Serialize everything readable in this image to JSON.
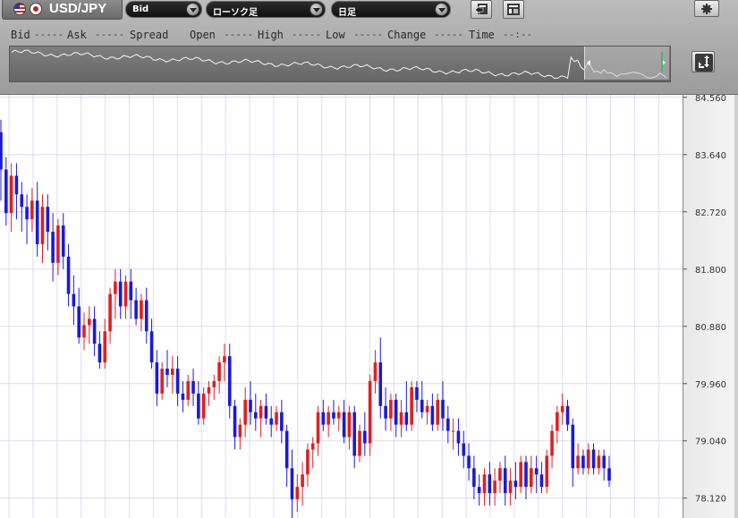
{
  "toolbar": {
    "pair": "USD/JPY",
    "price_type": "Bid",
    "chart_type": "ローソク足",
    "period": "日足"
  },
  "quote_strip": {
    "bid_label": "Bid",
    "bid_value": "-----",
    "ask_label": "Ask",
    "ask_value": "-----",
    "spread_label": "Spread",
    "spread_value": "",
    "open_label": "Open",
    "open_value": "-----",
    "high_label": "High",
    "high_value": "-----",
    "low_label": "Low",
    "low_value": "-----",
    "change_label": "Change",
    "change_value": "-----",
    "time_label": "Time",
    "time_value": "--:--"
  },
  "colors": {
    "up_candle": "#e02020",
    "down_candle": "#1a1ad8",
    "grid": "#dcdcf2"
  },
  "chart_data": {
    "type": "candlestick",
    "y_ticks": [
      "84.560",
      "83.640",
      "82.720",
      "81.800",
      "80.880",
      "79.960",
      "79.040",
      "78.120"
    ],
    "ylim": [
      77.8,
      84.6
    ],
    "candles": [
      [
        84.0,
        84.2,
        82.9,
        83.4
      ],
      [
        83.4,
        83.6,
        82.5,
        82.7
      ],
      [
        82.7,
        83.5,
        82.4,
        83.3
      ],
      [
        83.3,
        83.5,
        82.6,
        83.0
      ],
      [
        83.0,
        83.2,
        82.4,
        82.8
      ],
      [
        82.8,
        83.0,
        82.2,
        82.6
      ],
      [
        82.6,
        83.1,
        82.4,
        82.9
      ],
      [
        82.9,
        83.2,
        82.0,
        82.2
      ],
      [
        82.2,
        83.0,
        81.9,
        82.8
      ],
      [
        82.8,
        83.0,
        82.1,
        82.4
      ],
      [
        82.4,
        82.7,
        81.6,
        81.9
      ],
      [
        81.9,
        82.6,
        81.7,
        82.5
      ],
      [
        82.5,
        82.7,
        81.8,
        82.0
      ],
      [
        82.0,
        82.2,
        81.2,
        81.4
      ],
      [
        81.4,
        81.7,
        80.9,
        81.2
      ],
      [
        81.2,
        81.5,
        80.6,
        80.7
      ],
      [
        80.7,
        81.1,
        80.5,
        80.9
      ],
      [
        80.9,
        81.2,
        80.6,
        81.0
      ],
      [
        81.0,
        81.2,
        80.4,
        80.6
      ],
      [
        80.6,
        80.8,
        80.2,
        80.3
      ],
      [
        80.3,
        81.0,
        80.2,
        80.8
      ],
      [
        80.8,
        81.5,
        80.6,
        81.4
      ],
      [
        81.4,
        81.8,
        81.0,
        81.6
      ],
      [
        81.6,
        81.8,
        81.0,
        81.2
      ],
      [
        81.2,
        81.7,
        81.0,
        81.6
      ],
      [
        81.6,
        81.8,
        81.0,
        81.3
      ],
      [
        81.3,
        81.5,
        80.9,
        81.0
      ],
      [
        81.0,
        81.4,
        80.8,
        81.3
      ],
      [
        81.3,
        81.5,
        80.6,
        80.8
      ],
      [
        80.8,
        81.0,
        80.2,
        80.3
      ],
      [
        80.3,
        80.5,
        79.6,
        79.8
      ],
      [
        79.8,
        80.3,
        79.7,
        80.2
      ],
      [
        80.2,
        80.5,
        79.9,
        80.1
      ],
      [
        80.1,
        80.4,
        79.8,
        80.2
      ],
      [
        80.2,
        80.4,
        79.6,
        79.8
      ],
      [
        79.8,
        80.0,
        79.5,
        79.7
      ],
      [
        79.7,
        80.1,
        79.6,
        80.0
      ],
      [
        80.0,
        80.2,
        79.6,
        79.8
      ],
      [
        79.8,
        80.0,
        79.3,
        79.4
      ],
      [
        79.4,
        79.9,
        79.3,
        79.8
      ],
      [
        79.8,
        80.0,
        79.6,
        79.9
      ],
      [
        79.9,
        80.1,
        79.7,
        80.0
      ],
      [
        80.0,
        80.4,
        79.8,
        80.3
      ],
      [
        80.3,
        80.6,
        80.0,
        80.4
      ],
      [
        80.4,
        80.6,
        79.4,
        79.6
      ],
      [
        79.6,
        79.7,
        78.9,
        79.1
      ],
      [
        79.1,
        79.4,
        78.9,
        79.3
      ],
      [
        79.3,
        79.9,
        79.1,
        79.7
      ],
      [
        79.7,
        80.0,
        79.3,
        79.5
      ],
      [
        79.5,
        79.8,
        79.2,
        79.4
      ],
      [
        79.4,
        79.7,
        79.1,
        79.6
      ],
      [
        79.6,
        79.8,
        79.3,
        79.4
      ],
      [
        79.4,
        79.6,
        79.1,
        79.3
      ],
      [
        79.3,
        79.6,
        79.2,
        79.5
      ],
      [
        79.5,
        79.7,
        79.0,
        79.2
      ],
      [
        79.2,
        79.3,
        78.3,
        78.6
      ],
      [
        78.6,
        78.9,
        77.8,
        78.1
      ],
      [
        78.1,
        78.5,
        77.9,
        78.3
      ],
      [
        78.3,
        78.7,
        78.0,
        78.5
      ],
      [
        78.5,
        79.0,
        78.3,
        78.9
      ],
      [
        78.9,
        79.1,
        78.6,
        79.0
      ],
      [
        79.0,
        79.6,
        78.8,
        79.5
      ],
      [
        79.5,
        79.7,
        79.2,
        79.3
      ],
      [
        79.3,
        79.6,
        79.1,
        79.5
      ],
      [
        79.5,
        79.7,
        79.3,
        79.4
      ],
      [
        79.4,
        79.6,
        79.2,
        79.5
      ],
      [
        79.5,
        79.7,
        79.0,
        79.1
      ],
      [
        79.1,
        79.6,
        78.9,
        79.5
      ],
      [
        79.5,
        79.6,
        78.6,
        78.8
      ],
      [
        78.8,
        79.3,
        78.7,
        79.2
      ],
      [
        79.2,
        79.5,
        78.8,
        79.0
      ],
      [
        79.0,
        80.1,
        78.8,
        80.0
      ],
      [
        80.0,
        80.5,
        79.8,
        80.3
      ],
      [
        80.3,
        80.7,
        79.4,
        79.6
      ],
      [
        79.6,
        79.9,
        79.2,
        79.4
      ],
      [
        79.4,
        79.8,
        79.2,
        79.7
      ],
      [
        79.7,
        79.8,
        79.1,
        79.3
      ],
      [
        79.3,
        79.7,
        79.1,
        79.5
      ],
      [
        79.5,
        80.0,
        79.2,
        79.3
      ],
      [
        79.3,
        80.0,
        79.2,
        79.9
      ],
      [
        79.9,
        80.0,
        79.5,
        79.7
      ],
      [
        79.7,
        80.0,
        79.4,
        79.5
      ],
      [
        79.5,
        79.7,
        79.3,
        79.6
      ],
      [
        79.6,
        79.8,
        79.2,
        79.3
      ],
      [
        79.3,
        79.8,
        79.2,
        79.7
      ],
      [
        79.7,
        80.0,
        79.2,
        79.4
      ],
      [
        79.4,
        79.6,
        79.0,
        79.2
      ],
      [
        79.2,
        79.4,
        78.9,
        79.2
      ],
      [
        79.2,
        79.4,
        78.8,
        79.0
      ],
      [
        79.0,
        79.2,
        78.6,
        78.8
      ],
      [
        78.8,
        79.0,
        78.4,
        78.6
      ],
      [
        78.6,
        78.8,
        78.1,
        78.3
      ],
      [
        78.3,
        78.5,
        78.0,
        78.2
      ],
      [
        78.2,
        78.6,
        78.0,
        78.5
      ],
      [
        78.5,
        78.7,
        78.0,
        78.2
      ],
      [
        78.2,
        78.6,
        78.0,
        78.4
      ],
      [
        78.4,
        78.7,
        78.2,
        78.6
      ],
      [
        78.6,
        78.8,
        78.0,
        78.2
      ],
      [
        78.2,
        78.6,
        78.0,
        78.4
      ],
      [
        78.4,
        78.7,
        78.1,
        78.3
      ],
      [
        78.3,
        78.8,
        78.2,
        78.7
      ],
      [
        78.7,
        78.8,
        78.1,
        78.3
      ],
      [
        78.3,
        78.8,
        78.2,
        78.6
      ],
      [
        78.6,
        78.8,
        78.2,
        78.5
      ],
      [
        78.5,
        78.7,
        78.2,
        78.3
      ],
      [
        78.3,
        78.9,
        78.2,
        78.8
      ],
      [
        78.8,
        79.3,
        78.6,
        79.2
      ],
      [
        79.2,
        79.6,
        79.0,
        79.5
      ],
      [
        79.5,
        79.8,
        79.3,
        79.6
      ],
      [
        79.6,
        79.7,
        79.2,
        79.3
      ],
      [
        79.3,
        79.4,
        78.3,
        78.6
      ],
      [
        78.6,
        79.0,
        78.5,
        78.8
      ],
      [
        78.8,
        78.9,
        78.5,
        78.6
      ],
      [
        78.6,
        79.0,
        78.5,
        78.9
      ],
      [
        78.9,
        79.0,
        78.5,
        78.6
      ],
      [
        78.6,
        78.9,
        78.5,
        78.8
      ],
      [
        78.8,
        78.9,
        78.4,
        78.6
      ],
      [
        78.6,
        78.8,
        78.3,
        78.4
      ]
    ]
  }
}
